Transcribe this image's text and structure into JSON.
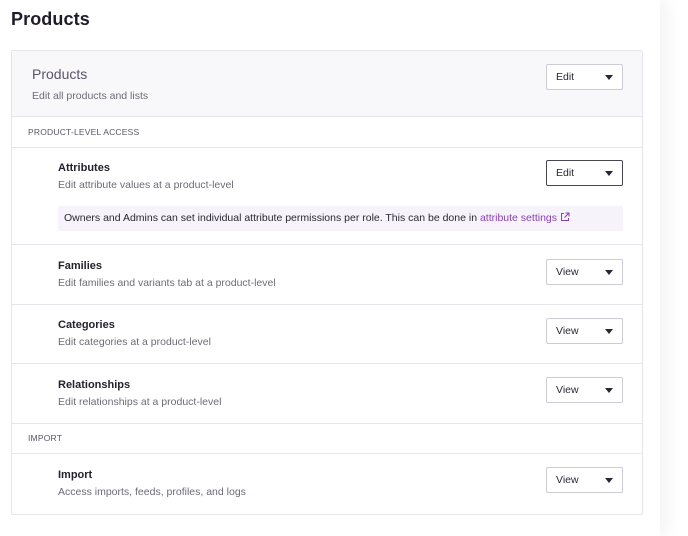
{
  "page": {
    "title": "Products"
  },
  "card": {
    "title": "Products",
    "subtitle": "Edit all products and lists",
    "select_value": "Edit"
  },
  "sections": [
    {
      "label": "PRODUCT-LEVEL ACCESS",
      "rows": [
        {
          "title": "Attributes",
          "description": "Edit attribute values at a product-level",
          "value": "Edit"
        },
        {
          "title": "Families",
          "description": "Edit families and variants tab at a product-level",
          "value": "View"
        },
        {
          "title": "Categories",
          "description": "Edit categories at a product-level",
          "value": "View"
        },
        {
          "title": "Relationships",
          "description": "Edit relationships at a product-level",
          "value": "View"
        }
      ]
    },
    {
      "label": "IMPORT",
      "rows": [
        {
          "title": "Import",
          "description": "Access imports, feeds, profiles, and logs",
          "value": "View"
        }
      ]
    }
  ],
  "info": {
    "text": "Owners and Admins can set individual attribute permissions per role. This can be done in ",
    "link_text": "attribute settings",
    "link_icon": "external-link-icon"
  },
  "colors": {
    "accent_link": "#8a3fb3",
    "info_background": "#f6f3fa",
    "header_background": "#f8f7fa"
  }
}
